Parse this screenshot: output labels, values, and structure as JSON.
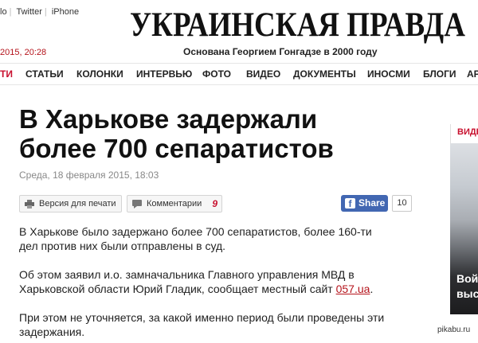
{
  "top_links": {
    "part1": "lo",
    "part2": "Twitter",
    "part3": "iPhone"
  },
  "datetime": "2015, 20:28",
  "masthead": {
    "logo": "УКРАИНСКАЯ ПРАВДА",
    "tagline": "Основана Георгием Гонгадзе в 2000 году"
  },
  "nav": {
    "items": [
      "ТИ",
      "СТАТЬИ",
      "КОЛОНКИ",
      "ИНТЕРВЬЮ",
      "ФОТО",
      "ВИДЕО",
      "ДОКУМЕНТЫ",
      "ИНОСМИ",
      "БЛОГИ",
      "АР"
    ]
  },
  "article": {
    "headline_line1": "В Харькове задержали",
    "headline_line2": "более 700 сепаратистов",
    "date": "Среда, 18 февраля 2015, 18:03",
    "print_label": "Версия для печати",
    "comments_label": "Комментарии",
    "comments_count": "9",
    "share_label": "Share",
    "share_count": "10",
    "p1_line1": "В Харькове было задержано более 700 сепаратистов, более 160-ти",
    "p1_line2": "дел против них были отправлены в суд.",
    "p2_line1": "Об этом заявил и.о. замначальника Главного управления МВД в",
    "p2_line2_text": "Харьковской области Юрий Гладик, сообщает местный сайт ",
    "p2_link": "057.ua",
    "p2_end": ".",
    "p3_line1": "При этом не уточняется, за какой именно период были проведены эти",
    "p3_line2": "задержания."
  },
  "sidebar": {
    "label": "ВИДЕ",
    "caption1": "Вой",
    "caption2": "выс"
  },
  "watermark": "pikabu.ru",
  "colors": {
    "accent_red": "#c8102e",
    "facebook_blue": "#4267b2"
  }
}
